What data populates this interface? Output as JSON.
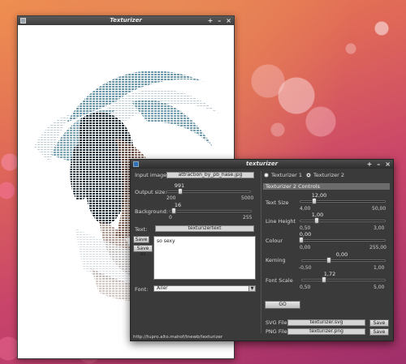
{
  "image_window": {
    "title": "Texturizer",
    "buttons": {
      "minimize": "+",
      "maximize": "–",
      "close": "×"
    }
  },
  "main_window": {
    "title": "texturizer",
    "buttons": {
      "minimize": "+",
      "maximize": "–",
      "close": "×"
    },
    "left": {
      "input_image_label": "Input image",
      "input_image_value": "attraction_by_pb_hase.jpg",
      "output_size_label": "Output size:",
      "output_size": {
        "value": "991",
        "min": "200",
        "max": "5000",
        "fraction": 0.16
      },
      "background_label": "Background:",
      "background": {
        "value": "16",
        "min": "0",
        "max": "255",
        "fraction": 0.06
      },
      "text_label": "Text:",
      "text_value": "texturizertext",
      "load_button": "Save",
      "save_as_button": "Save as",
      "textarea_text": "so sexy",
      "font_label": "Font:",
      "font_value": "Ailer",
      "status_url": "http://tupro.alto.mahof/tnewb/texturizer"
    },
    "right": {
      "radio_1": "Texturizer 1",
      "radio_2": "Texturizer 2",
      "section_title": "Texturizer 2 Controls",
      "text_size": {
        "label": "Text Size",
        "value": "12,00",
        "min": "4,00",
        "max": "50,00",
        "fraction": 0.17
      },
      "line_height": {
        "label": "Line Height",
        "value": "1,00",
        "min": "0,50",
        "max": "3,00",
        "fraction": 0.2
      },
      "colour": {
        "label": "Colour",
        "value": "0,00",
        "min": "0,00",
        "max": "255,00",
        "fraction": 0.0
      },
      "kerning": {
        "label": "Kerning",
        "value": "0,00",
        "min": "-0,50",
        "max": "1,00",
        "fraction": 0.33
      },
      "font_scale": {
        "label": "Font Scale",
        "value": "1,72",
        "min": "0,50",
        "max": "5,00",
        "fraction": 0.27
      },
      "go_button": "GO",
      "svg_file_label": "SVG File:",
      "svg_file_value": "texturizer.svg",
      "png_file_label": "PNG File:",
      "png_file_value": "texturizer.png",
      "save_svg_button": "Save",
      "save_png_button": "Save"
    }
  },
  "colors": {
    "window_bg": "#3a3a3a",
    "titlebar": "#3c3c3c",
    "art_dark": "#23323e",
    "art_teal": "#5f8fa3",
    "art_brown": "#6b4a3a"
  }
}
